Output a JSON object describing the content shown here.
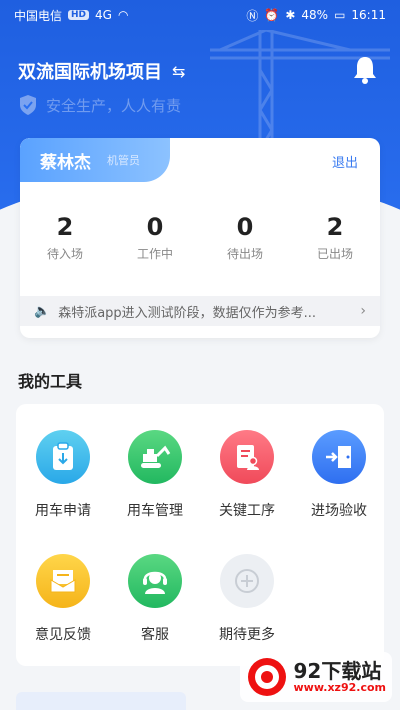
{
  "statusbar": {
    "carrier": "中国电信",
    "hd": "HD",
    "signal": "4G",
    "battery": "48%",
    "time": "16:11"
  },
  "header": {
    "project_name": "双流国际机场项目",
    "slogan": "安全生产，人人有责"
  },
  "user": {
    "name": "蔡林杰",
    "role": "机管员",
    "logout_label": "退出"
  },
  "stats": [
    {
      "value": "2",
      "label": "待入场"
    },
    {
      "value": "0",
      "label": "工作中"
    },
    {
      "value": "0",
      "label": "待出场"
    },
    {
      "value": "2",
      "label": "已出场"
    }
  ],
  "notice": {
    "text": "森特派app进入测试阶段，数据仅作为参考..."
  },
  "tools_section": {
    "title": "我的工具",
    "items": [
      {
        "label": "用车申请",
        "icon": "clipboard-download-icon",
        "color": "#2aa8e8"
      },
      {
        "label": "用车管理",
        "icon": "excavator-icon",
        "color": "#22b860"
      },
      {
        "label": "关键工序",
        "icon": "document-user-icon",
        "color": "#f04a5a"
      },
      {
        "label": "进场验收",
        "icon": "enter-door-icon",
        "color": "#2f6ff0"
      },
      {
        "label": "意见反馈",
        "icon": "feedback-mail-icon",
        "color": "#f5b41a"
      },
      {
        "label": "客服",
        "icon": "headset-agent-icon",
        "color": "#22b860"
      },
      {
        "label": "期待更多",
        "icon": "plus-circle-icon",
        "color": "#c8cdd4"
      }
    ]
  },
  "watermark": {
    "name": "92下载站",
    "url": "www.xz92.com"
  },
  "colors": {
    "primary": "#1f5fe0",
    "accent": "#3a7bf0"
  }
}
